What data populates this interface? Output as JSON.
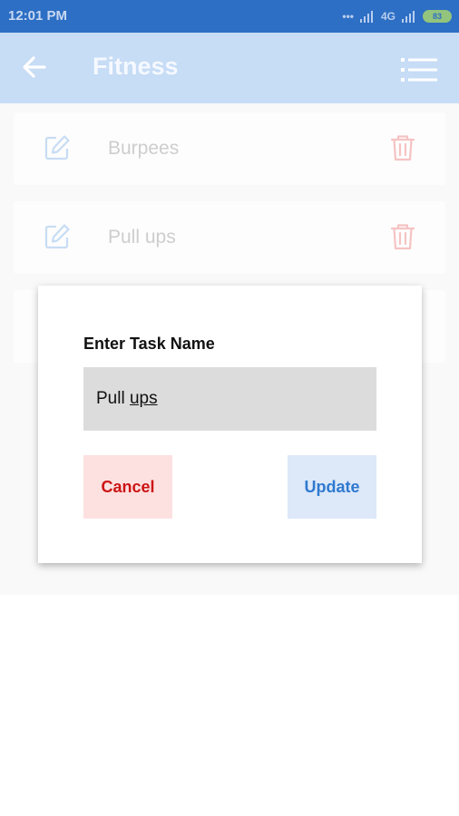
{
  "status_bar": {
    "time": "12:01 PM",
    "network": "4G",
    "battery": "83"
  },
  "app_bar": {
    "title": "Fitness",
    "back_icon": "arrow-left-icon",
    "menu_icon": "list-menu-icon",
    "color": "#c7dcf5"
  },
  "tasks": [
    {
      "name": "Burpees",
      "edit_icon": "edit-icon",
      "delete_icon": "trash-icon"
    },
    {
      "name": "Pull ups",
      "edit_icon": "edit-icon",
      "delete_icon": "trash-icon"
    }
  ],
  "dialog": {
    "label": "Enter Task Name",
    "input_value_part1": "Pull ",
    "input_value_part2": "ups",
    "cancel_label": "Cancel",
    "update_label": "Update",
    "cancel_color": "#cc1414",
    "update_color": "#2f7ad0"
  }
}
